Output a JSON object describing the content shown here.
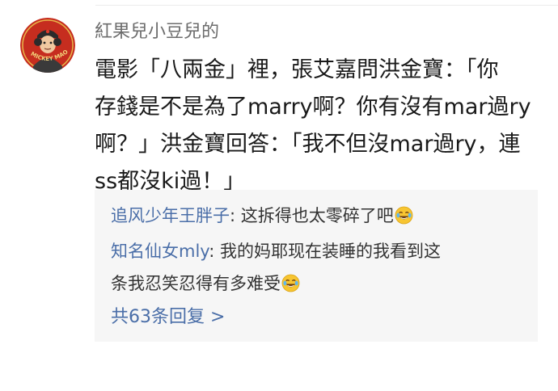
{
  "comment": {
    "username": "紅果兒小豆兒的",
    "avatar_icon": "avatar-portrait-icon",
    "avatar_text": "MICKEY MAO",
    "content_lines": [
      "電影「八兩金」裡，張艾嘉問洪金寶：「你",
      "存錢是不是為了marry啊？你有沒有mar過ry",
      "啊？」洪金寶回答：「我不但沒mar過ry，連",
      "ss都沒ki過！」"
    ]
  },
  "replies": [
    {
      "author": "追风少年王胖子",
      "separator": ": ",
      "text_lines": [
        "这拆得也太零碎了吧"
      ],
      "emoji": "laugh-cry-emoji-icon"
    },
    {
      "author": "知名仙女mly",
      "separator": ": ",
      "text_lines": [
        "我的妈耶现在装睡的我看到这",
        "条我忍笑忍得有多难受"
      ],
      "emoji": "laugh-cry-emoji-icon"
    }
  ],
  "more_replies": {
    "label": "共63条回复 >"
  },
  "colors": {
    "link": "#4a6ea8",
    "reply_background": "#f6f6f6",
    "username": "#6c6c6c",
    "avatar_background": "#c62d1f"
  }
}
